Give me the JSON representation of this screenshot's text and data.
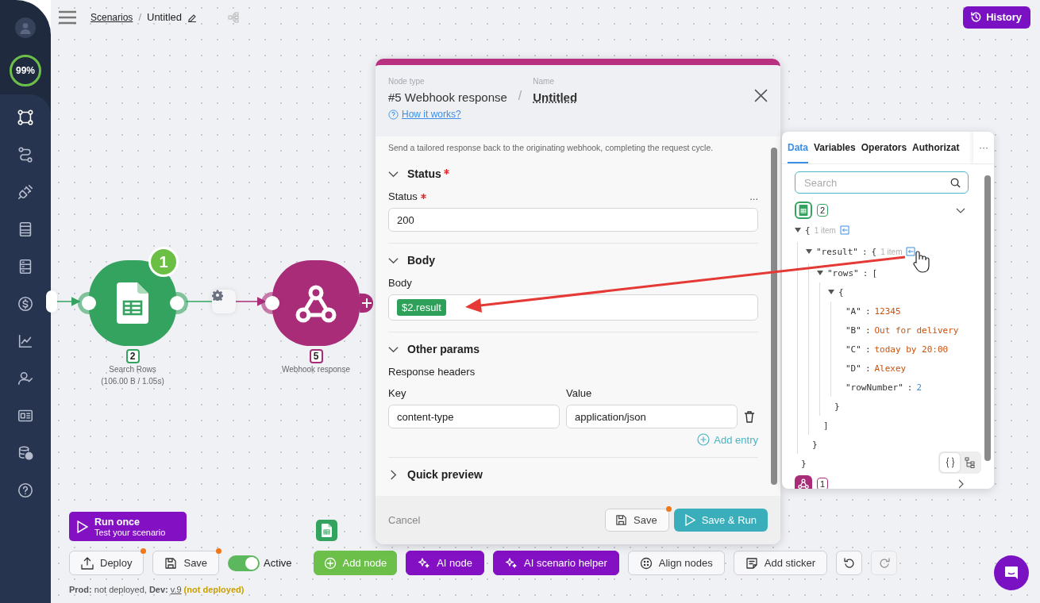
{
  "sidebar": {
    "usage": "99%"
  },
  "header": {
    "breadcrumb": [
      {
        "label": "Scenarios",
        "kind": "link"
      },
      {
        "label": "Untitled",
        "kind": "current"
      }
    ],
    "separator": "/",
    "history_button": "History"
  },
  "nodes": [
    {
      "kind": "sheets",
      "color": "#34a35f",
      "number": "2",
      "label": "Search Rows",
      "stats": "(106.00 B / 1.05s)",
      "badge": "1"
    },
    {
      "kind": "webhook",
      "color": "#a82c78",
      "number": "5",
      "label": "Webhook response"
    }
  ],
  "panel": {
    "type_label": "Node type",
    "type": "#5 Webhook response",
    "name_label": "Name",
    "name": "Untitled",
    "help": "How it works?",
    "description": "Send a tailored response back to the originating webhook, completing the request cycle.",
    "sections": [
      {
        "kind": "status",
        "title": "Status",
        "required": true,
        "expanded": true,
        "field": {
          "label": "Status",
          "required": true,
          "menu": "...",
          "value": "200"
        }
      },
      {
        "kind": "body",
        "title": "Body",
        "required": false,
        "expanded": true,
        "field": {
          "label": "Body",
          "required": false,
          "token": "$2.result"
        }
      },
      {
        "kind": "headers",
        "title": "Other params",
        "required": false,
        "expanded": true,
        "label": "Response headers",
        "key_label": "Key",
        "value_label": "Value",
        "rows": [
          {
            "key": "content-type",
            "value": "application/json"
          }
        ],
        "add": "Add entry"
      },
      {
        "kind": "preview",
        "title": "Quick preview",
        "required": false,
        "expanded": false
      }
    ],
    "cancel": "Cancel",
    "save": {
      "label": "Save",
      "modified": true
    },
    "save_run": "Save & Run"
  },
  "data_panel": {
    "tabs": [
      {
        "label": "Data",
        "selected": true
      },
      {
        "label": "Variables",
        "selected": false
      },
      {
        "label": "Operators",
        "selected": false
      },
      {
        "label": "Authorizat",
        "selected": false
      }
    ],
    "more": "···",
    "search": {
      "placeholder": "Search"
    },
    "separator": ":",
    "sources": [
      {
        "kind": "sheets",
        "color": "#34a35f",
        "number": "2",
        "expanded": true,
        "tree": {
          "open": "{",
          "count": "1 item",
          "expanded": true,
          "close": "}",
          "children": [
            {
              "key": "\"result\"",
              "open": "{",
              "count": "1 item",
              "expanded": true,
              "close": "}",
              "children": [
                {
                  "key": "\"rows\"",
                  "open": "[",
                  "expanded": true,
                  "close": "]",
                  "children": [
                    {
                      "open": "{",
                      "expanded": true,
                      "close": "}",
                      "children": [
                        {
                          "key": "\"A\"",
                          "value": "12345",
                          "kind": "string"
                        },
                        {
                          "key": "\"B\"",
                          "value": "Out for delivery",
                          "kind": "string"
                        },
                        {
                          "key": "\"C\"",
                          "value": "today by 20:00",
                          "kind": "string"
                        },
                        {
                          "key": "\"D\"",
                          "value": "Alexey",
                          "kind": "string"
                        },
                        {
                          "key": "\"rowNumber\"",
                          "value": "2",
                          "kind": "number"
                        }
                      ]
                    }
                  ]
                }
              ]
            }
          ]
        }
      },
      {
        "kind": "webhook",
        "color": "#a82c78",
        "number": "1",
        "expanded": false
      }
    ],
    "view_modes": [
      {
        "kind": "code",
        "selected": true
      },
      {
        "kind": "tree",
        "selected": false
      }
    ]
  },
  "run_once": {
    "title": "Run once",
    "subtitle": "Test your scenario"
  },
  "toolbar": [
    {
      "kind": "deploy",
      "label": "Deploy",
      "modified": true
    },
    {
      "kind": "save",
      "label": "Save",
      "modified": true
    },
    {
      "kind": "toggle",
      "label": "Active",
      "on": true
    },
    {
      "kind": "add",
      "label": "Add node"
    },
    {
      "kind": "ai",
      "label": "AI node"
    },
    {
      "kind": "ai",
      "label": "AI scenario helper"
    },
    {
      "kind": "align",
      "label": "Align nodes"
    },
    {
      "kind": "sticker",
      "label": "Add sticker"
    },
    {
      "kind": "undo",
      "disabled": false
    },
    {
      "kind": "redo",
      "disabled": true
    }
  ],
  "status": {
    "text": "**Prod:** not deployed, **Dev:**",
    "link": "v.9",
    "note": "(not deployed)"
  }
}
